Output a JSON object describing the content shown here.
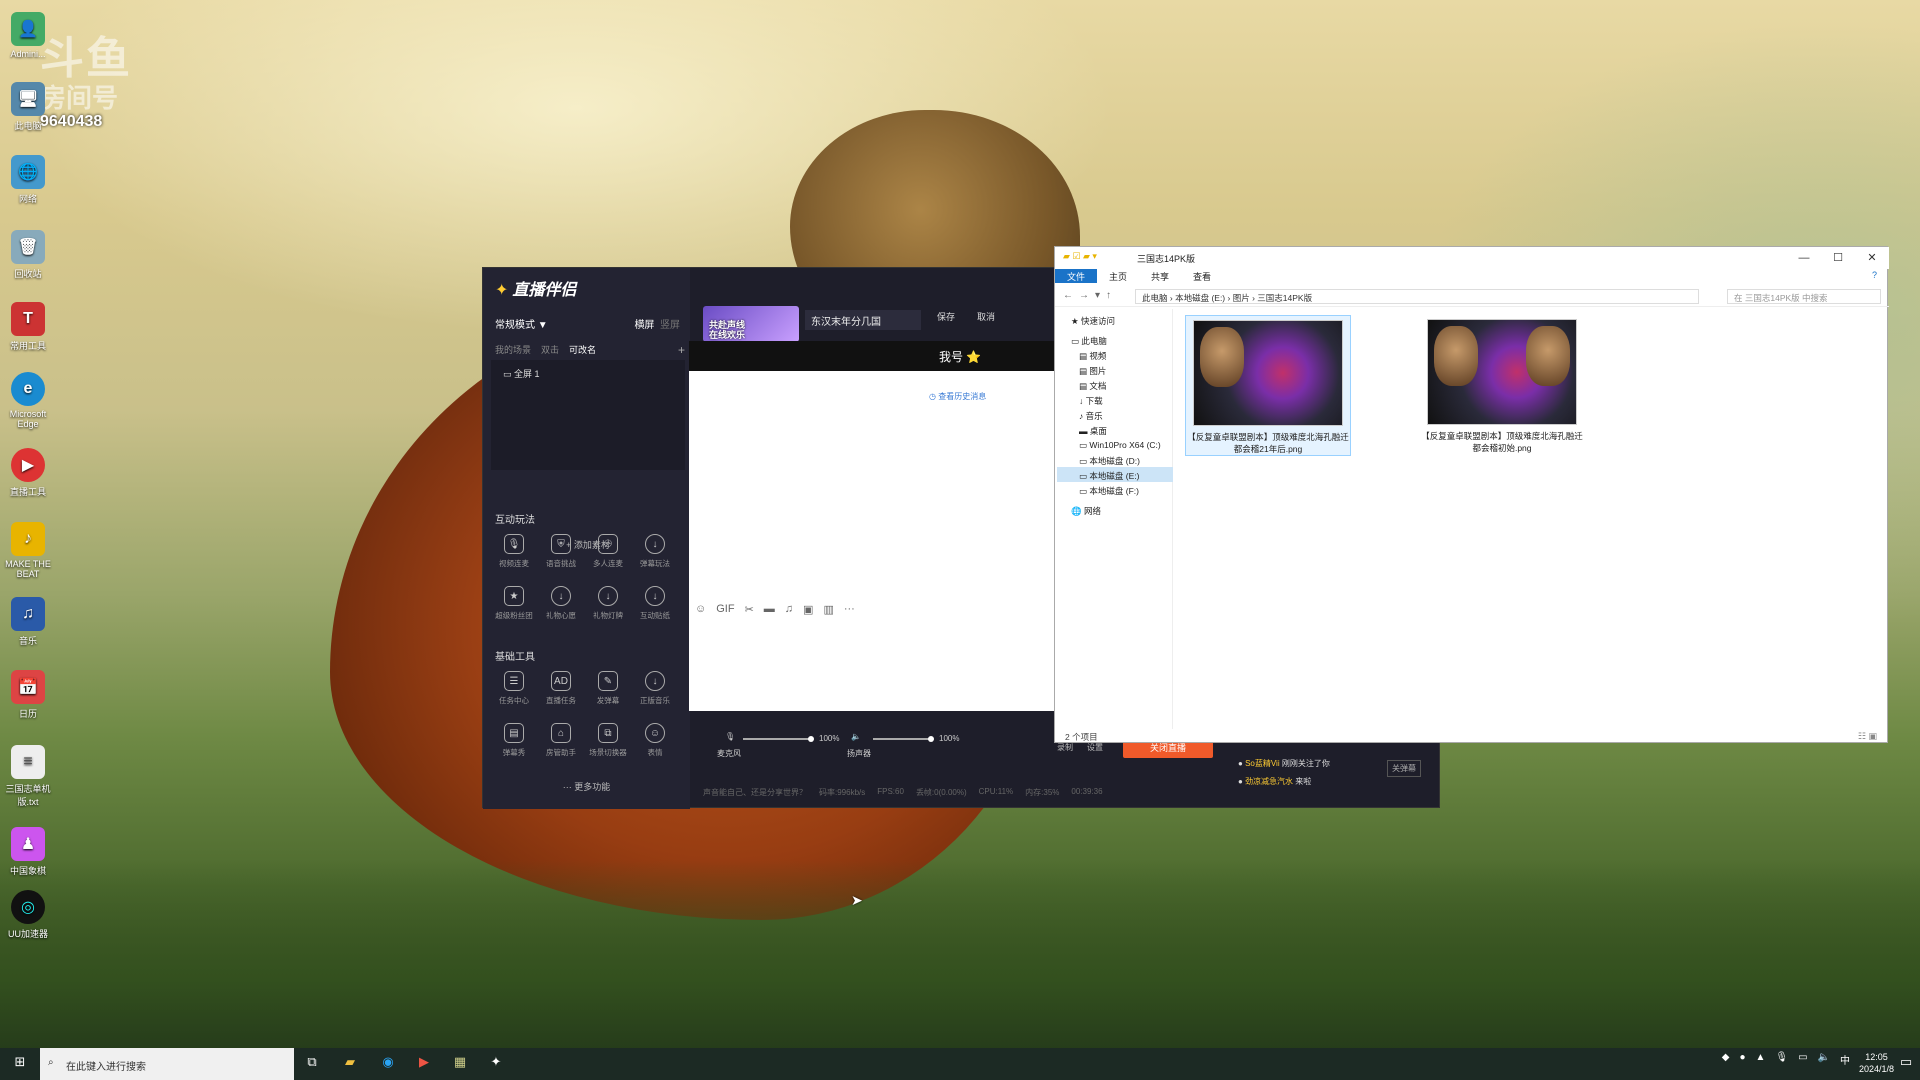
{
  "desktop": {
    "watermark": "斗鱼",
    "watermark_sub": "房间号",
    "room_number": "9640438",
    "icons": [
      {
        "label": "Admini...",
        "icon": "user-icon"
      },
      {
        "label": "此电脑",
        "icon": "computer-icon"
      },
      {
        "label": "网络",
        "icon": "network-icon"
      },
      {
        "label": "回收站",
        "icon": "recycle-bin-icon"
      },
      {
        "label": "常用工具",
        "icon": "tools-icon"
      },
      {
        "label": "Microsoft Edge",
        "icon": "edge-icon"
      },
      {
        "label": "直播工具",
        "icon": "stream-tool-icon"
      },
      {
        "label": "MAKE THE BEAT",
        "icon": "beat-icon"
      },
      {
        "label": "音乐",
        "icon": "music-icon"
      },
      {
        "label": "日历",
        "icon": "calendar-icon"
      },
      {
        "label": "三国志单机版.txt",
        "icon": "text-file-icon"
      },
      {
        "label": "中国象棋",
        "icon": "chess-icon"
      },
      {
        "label": "UU加速器",
        "icon": "uu-icon"
      }
    ]
  },
  "stream_app": {
    "logo": "直播伴侣",
    "mode": "常规模式 ▼",
    "mode_opts": [
      "横屏",
      "竖屏"
    ],
    "scene_tabs": [
      "我的场景",
      "双击",
      "可改名"
    ],
    "scene_item": "全屏 1",
    "add_source": "+ 添加素材",
    "sections": {
      "interactive": "互动玩法",
      "basic": "基础工具"
    },
    "interactive_tools": [
      "视频连麦",
      "语音挑战",
      "多人连麦",
      "弹幕玩法",
      "超级粉丝团",
      "礼物心愿",
      "礼物灯牌",
      "互动贴纸"
    ],
    "basic_tools": [
      "任务中心",
      "直播任务",
      "发弹幕",
      "正版音乐",
      "弹幕秀",
      "房管助手",
      "场景切换器",
      "表情"
    ],
    "more": "··· 更多功能",
    "cover_text": "共赴声线\n在线欢乐",
    "room_title": "东汉末年分几国",
    "save": "保存",
    "cancel": "取消",
    "chat_name": "我号 ⭐",
    "history": "查看历史消息",
    "mic_label": "麦克风",
    "mic_pct": "100%",
    "speaker_label": "扬声器",
    "speaker_pct": "100%",
    "mic_level": 1.0,
    "speaker_level": 1.0,
    "record": "录制",
    "settings": "设置",
    "start_live": "关闭直播",
    "notif_follow_user": "So蓝精Vii",
    "notif_follow_text": "刚刚关注了你",
    "notif_btn": "关弹幕",
    "notif_2_user": "劲凉减急汽水",
    "notif_2_text": "来啦",
    "status_hint": "声音能自己、还是分享世界？",
    "bitrate": "码率:996kb/s",
    "fps": "FPS:60",
    "drop": "丢帧:0(0.00%)",
    "cpu": "CPU:11%",
    "mem": "内存:35%",
    "time": "00:39:36"
  },
  "explorer": {
    "title": "三国志14PK版",
    "tabs": [
      "文件",
      "主页",
      "共享",
      "查看"
    ],
    "path": [
      "此电脑",
      "本地磁盘 (E:)",
      "图片",
      "三国志14PK版"
    ],
    "search_placeholder": "在 三国志14PK版 中搜索",
    "nav": [
      {
        "label": "快速访问"
      },
      {
        "label": "此电脑"
      },
      {
        "label": "视频"
      },
      {
        "label": "图片"
      },
      {
        "label": "文档"
      },
      {
        "label": "下载"
      },
      {
        "label": "音乐"
      },
      {
        "label": "桌面"
      },
      {
        "label": "Win10Pro X64 (C:)"
      },
      {
        "label": "本地磁盘 (D:)"
      },
      {
        "label": "本地磁盘 (E:)"
      },
      {
        "label": "本地磁盘 (F:)"
      },
      {
        "label": "网络"
      }
    ],
    "files": [
      {
        "name": "【反复童卓联盟剧本】顶级难度北海孔融迁都会稽21年后.png"
      },
      {
        "name": "【反复童卓联盟剧本】顶级难度北海孔融迁都会稽初始.png"
      }
    ],
    "status": "2 个项目"
  },
  "taskbar": {
    "search_placeholder": "在此键入进行搜索",
    "ime": "中",
    "time": "12:05",
    "date": "2024/1/8"
  }
}
